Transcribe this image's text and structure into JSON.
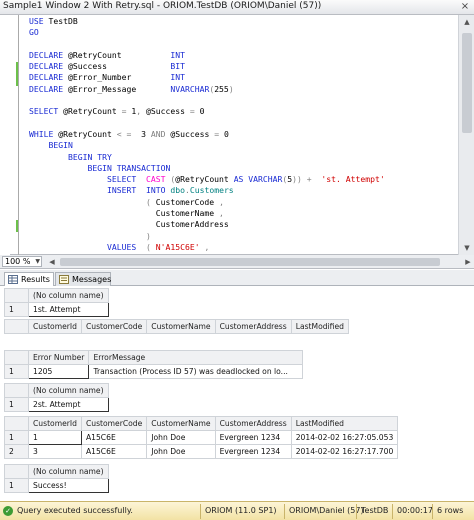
{
  "window": {
    "title": "Sample1 Window 2 With Retry.sql - ORIOM.TestDB (ORIOM\\Daniel (57))",
    "close_glyph": "×"
  },
  "editor": {
    "lines": [
      [
        {
          "c": "kw",
          "t": "USE "
        },
        {
          "c": "txt",
          "t": "TestDB"
        }
      ],
      [
        {
          "c": "kw",
          "t": "GO"
        }
      ],
      [],
      [
        {
          "c": "kw",
          "t": "DECLARE "
        },
        {
          "c": "txt",
          "t": "@RetryCount          "
        },
        {
          "c": "ty",
          "t": "INT"
        }
      ],
      [
        {
          "c": "kw",
          "t": "DECLARE "
        },
        {
          "c": "txt",
          "t": "@Success             "
        },
        {
          "c": "ty",
          "t": "BIT"
        }
      ],
      [
        {
          "c": "kw",
          "t": "DECLARE "
        },
        {
          "c": "txt",
          "t": "@Error_Number        "
        },
        {
          "c": "ty",
          "t": "INT"
        }
      ],
      [
        {
          "c": "kw",
          "t": "DECLARE "
        },
        {
          "c": "txt",
          "t": "@Error_Message       "
        },
        {
          "c": "ty",
          "t": "NVARCHAR"
        },
        {
          "c": "op",
          "t": "("
        },
        {
          "c": "txt",
          "t": "255"
        },
        {
          "c": "op",
          "t": ")"
        }
      ],
      [],
      [
        {
          "c": "kw",
          "t": "SELECT "
        },
        {
          "c": "txt",
          "t": "@RetryCount "
        },
        {
          "c": "op",
          "t": "="
        },
        {
          "c": "txt",
          "t": " 1"
        },
        {
          "c": "op",
          "t": ","
        },
        {
          "c": "txt",
          "t": " @Success "
        },
        {
          "c": "op",
          "t": "="
        },
        {
          "c": "txt",
          "t": " 0"
        }
      ],
      [],
      [
        {
          "c": "kw",
          "t": "WHILE "
        },
        {
          "c": "txt",
          "t": "@RetryCount "
        },
        {
          "c": "op",
          "t": "<"
        },
        {
          "c": "txt",
          "t": " "
        },
        {
          "c": "op",
          "t": "="
        },
        {
          "c": "txt",
          "t": "  3 "
        },
        {
          "c": "op",
          "t": "AND"
        },
        {
          "c": "txt",
          "t": " @Success "
        },
        {
          "c": "op",
          "t": "="
        },
        {
          "c": "txt",
          "t": " 0"
        }
      ],
      [
        {
          "c": "txt",
          "t": "    "
        },
        {
          "c": "kw",
          "t": "BEGIN"
        }
      ],
      [
        {
          "c": "txt",
          "t": "        "
        },
        {
          "c": "kw",
          "t": "BEGIN TRY"
        }
      ],
      [
        {
          "c": "txt",
          "t": "            "
        },
        {
          "c": "kw",
          "t": "BEGIN TRANSACTION"
        }
      ],
      [
        {
          "c": "txt",
          "t": "                "
        },
        {
          "c": "kw",
          "t": "SELECT  "
        },
        {
          "c": "fn",
          "t": "CAST"
        },
        {
          "c": "txt",
          "t": " "
        },
        {
          "c": "op",
          "t": "("
        },
        {
          "c": "txt",
          "t": "@RetryCount "
        },
        {
          "c": "kw",
          "t": "AS VARCHAR"
        },
        {
          "c": "op",
          "t": "("
        },
        {
          "c": "txt",
          "t": "5"
        },
        {
          "c": "op",
          "t": "))"
        },
        {
          "c": "txt",
          "t": " "
        },
        {
          "c": "op",
          "t": "+"
        },
        {
          "c": "txt",
          "t": "  "
        },
        {
          "c": "str",
          "t": "'st. Attempt'"
        }
      ],
      [
        {
          "c": "txt",
          "t": "                "
        },
        {
          "c": "kw",
          "t": "INSERT  INTO "
        },
        {
          "c": "obj",
          "t": "dbo"
        },
        {
          "c": "op",
          "t": "."
        },
        {
          "c": "obj",
          "t": "Customers"
        }
      ],
      [
        {
          "c": "txt",
          "t": "                        "
        },
        {
          "c": "op",
          "t": "("
        },
        {
          "c": "txt",
          "t": " CustomerCode "
        },
        {
          "c": "op",
          "t": ","
        }
      ],
      [
        {
          "c": "txt",
          "t": "                          CustomerName "
        },
        {
          "c": "op",
          "t": ","
        }
      ],
      [
        {
          "c": "txt",
          "t": "                          CustomerAddress"
        }
      ],
      [
        {
          "c": "txt",
          "t": "                        "
        },
        {
          "c": "op",
          "t": ")"
        }
      ],
      [
        {
          "c": "txt",
          "t": "                "
        },
        {
          "c": "kw",
          "t": "VALUES"
        },
        {
          "c": "txt",
          "t": "  "
        },
        {
          "c": "op",
          "t": "("
        },
        {
          "c": "txt",
          "t": " "
        },
        {
          "c": "str",
          "t": "N'A15C6E'"
        },
        {
          "c": "txt",
          "t": " "
        },
        {
          "c": "op",
          "t": ","
        }
      ]
    ]
  },
  "zoom": {
    "value": "100 %"
  },
  "tabs": [
    {
      "label": "Results",
      "icon": "grid-icon",
      "active": true
    },
    {
      "label": "Messages",
      "icon": "messages-icon",
      "active": false
    }
  ],
  "results": [
    {
      "columns": [
        "(No column name)"
      ],
      "rows": [
        [
          "1",
          "1st. Attempt"
        ]
      ]
    },
    {
      "columns": [
        "CustomerId",
        "CustomerCode",
        "CustomerName",
        "CustomerAddress",
        "LastModified"
      ],
      "rows": []
    },
    {
      "columns": [
        "Error Number",
        "ErrorMessage"
      ],
      "rows": [
        [
          "1",
          "1205",
          "Transaction (Process ID 57) was deadlocked on lo..."
        ]
      ]
    },
    {
      "columns": [
        "(No column name)"
      ],
      "rows": [
        [
          "1",
          "2st. Attempt"
        ]
      ]
    },
    {
      "columns": [
        "CustomerId",
        "CustomerCode",
        "CustomerName",
        "CustomerAddress",
        "LastModified"
      ],
      "rows": [
        [
          "1",
          "1",
          "A15C6E",
          "John Doe",
          "Evergreen 1234",
          "2014-02-02 16:27:05.053"
        ],
        [
          "2",
          "3",
          "A15C6E",
          "John Doe",
          "Evergreen 1234",
          "2014-02-02 16:27:17.700"
        ]
      ]
    },
    {
      "columns": [
        "(No column name)"
      ],
      "rows": [
        [
          "1",
          "Success!"
        ]
      ]
    }
  ],
  "status": {
    "message": "Query executed successfully.",
    "server": "ORIOM (11.0 SP1)",
    "user": "ORIOM\\Daniel (57)",
    "database": "TestDB",
    "elapsed": "00:00:17",
    "rows": "6 rows",
    "ok_glyph": "✓"
  },
  "colors": {
    "keyword": "#1a2bd3",
    "function": "#ff00cc",
    "string": "#d00000",
    "operator": "#808080",
    "status_bg": "#f6e9b3"
  }
}
